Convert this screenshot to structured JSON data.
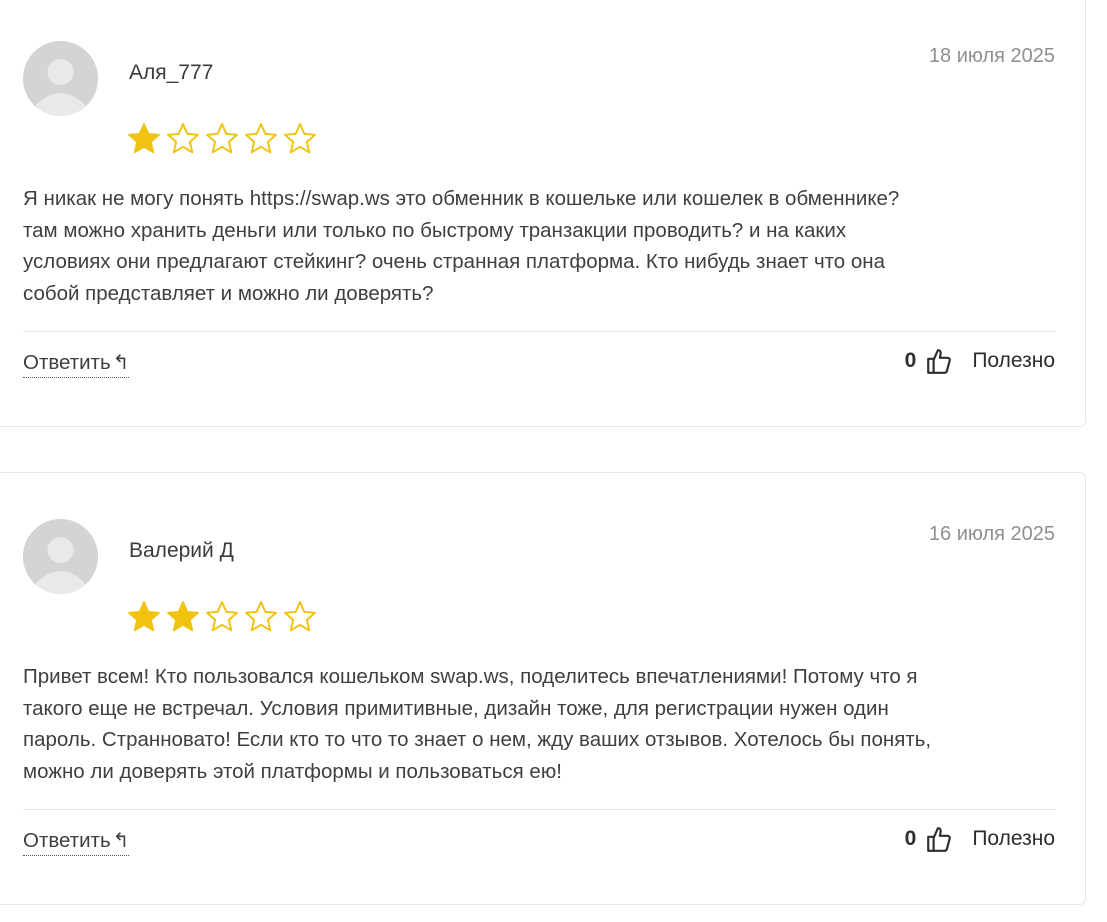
{
  "reviews": [
    {
      "author": "Аля_777",
      "date": "18 июля 2025",
      "rating": 1,
      "max_rating": 5,
      "text_lines": [
        "Я никак не могу понять https://swap.ws это обменник в кошельке или кошелек в обменнике?",
        "там можно хранить деньги или только по быстрому транзакции проводить? и на каких",
        "условиях они предлагают стейкинг? очень странная платформа. Кто нибудь знает что она",
        "собой представляет и можно ли доверять?"
      ],
      "reply_label": "Ответить",
      "likes": "0",
      "useful_label": "Полезно"
    },
    {
      "author": "Валерий Д",
      "date": "16 июля 2025",
      "rating": 2,
      "max_rating": 5,
      "text_lines": [
        "Привет всем! Кто пользовался кошельком swap.ws, поделитесь впечатлениями! Потому что я",
        "такого еще не встречал. Условия примитивные, дизайн тоже, для регистрации нужен один",
        "пароль. Странновато! Если кто то что то знает о нем, жду ваших отзывов. Хотелось бы понять,",
        "можно ли доверять этой платформы и пользоваться ею!"
      ],
      "reply_label": "Ответить",
      "likes": "0",
      "useful_label": "Полезно"
    }
  ],
  "icons": {
    "reply": "reply-arrow-icon",
    "like": "thumbs-up-icon",
    "avatar": "user-placeholder-icon",
    "star": "star-icon"
  },
  "colors": {
    "star_filled": "#EFC30F",
    "star_outline": "#EFC30F",
    "date": "#8f8f8f"
  }
}
